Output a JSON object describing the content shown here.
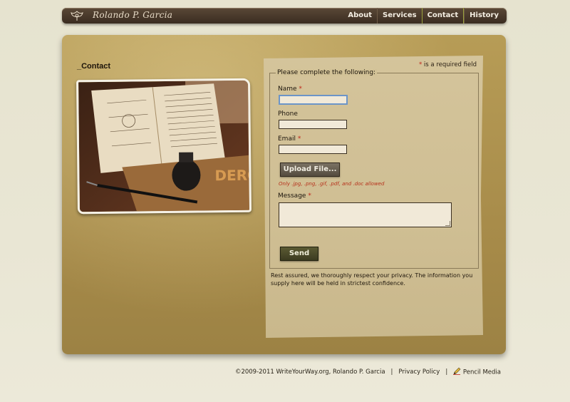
{
  "header": {
    "site_title": "Rolando P. Garcia",
    "nav": [
      {
        "label": "About"
      },
      {
        "label": "Services"
      },
      {
        "label": "Contact",
        "active": true
      },
      {
        "label": "History"
      }
    ]
  },
  "page": {
    "heading": "_Contact"
  },
  "form": {
    "required_note": " is a required field",
    "required_mark": "*",
    "legend": "Please complete the following:",
    "fields": {
      "name_label": "Name",
      "phone_label": "Phone",
      "email_label": "Email",
      "message_label": "Message"
    },
    "upload_label": "Upload File...",
    "upload_note": "Only .jpg, .png, .gif, .pdf, and .doc allowed",
    "send_label": "Send",
    "privacy": "Rest assured, we thoroughly respect your privacy. The information you supply here will be held in strictest confidence."
  },
  "footer": {
    "copyright": "©2009-2011 WriteYourWay.org, Rolando P. Garcia",
    "separator": "|",
    "privacy_link": "Privacy Policy",
    "credit_link": "Pencil Media"
  },
  "colors": {
    "accent_required": "#c0261a",
    "nav_bar": "#3a2c20",
    "panel": "#a58948"
  }
}
